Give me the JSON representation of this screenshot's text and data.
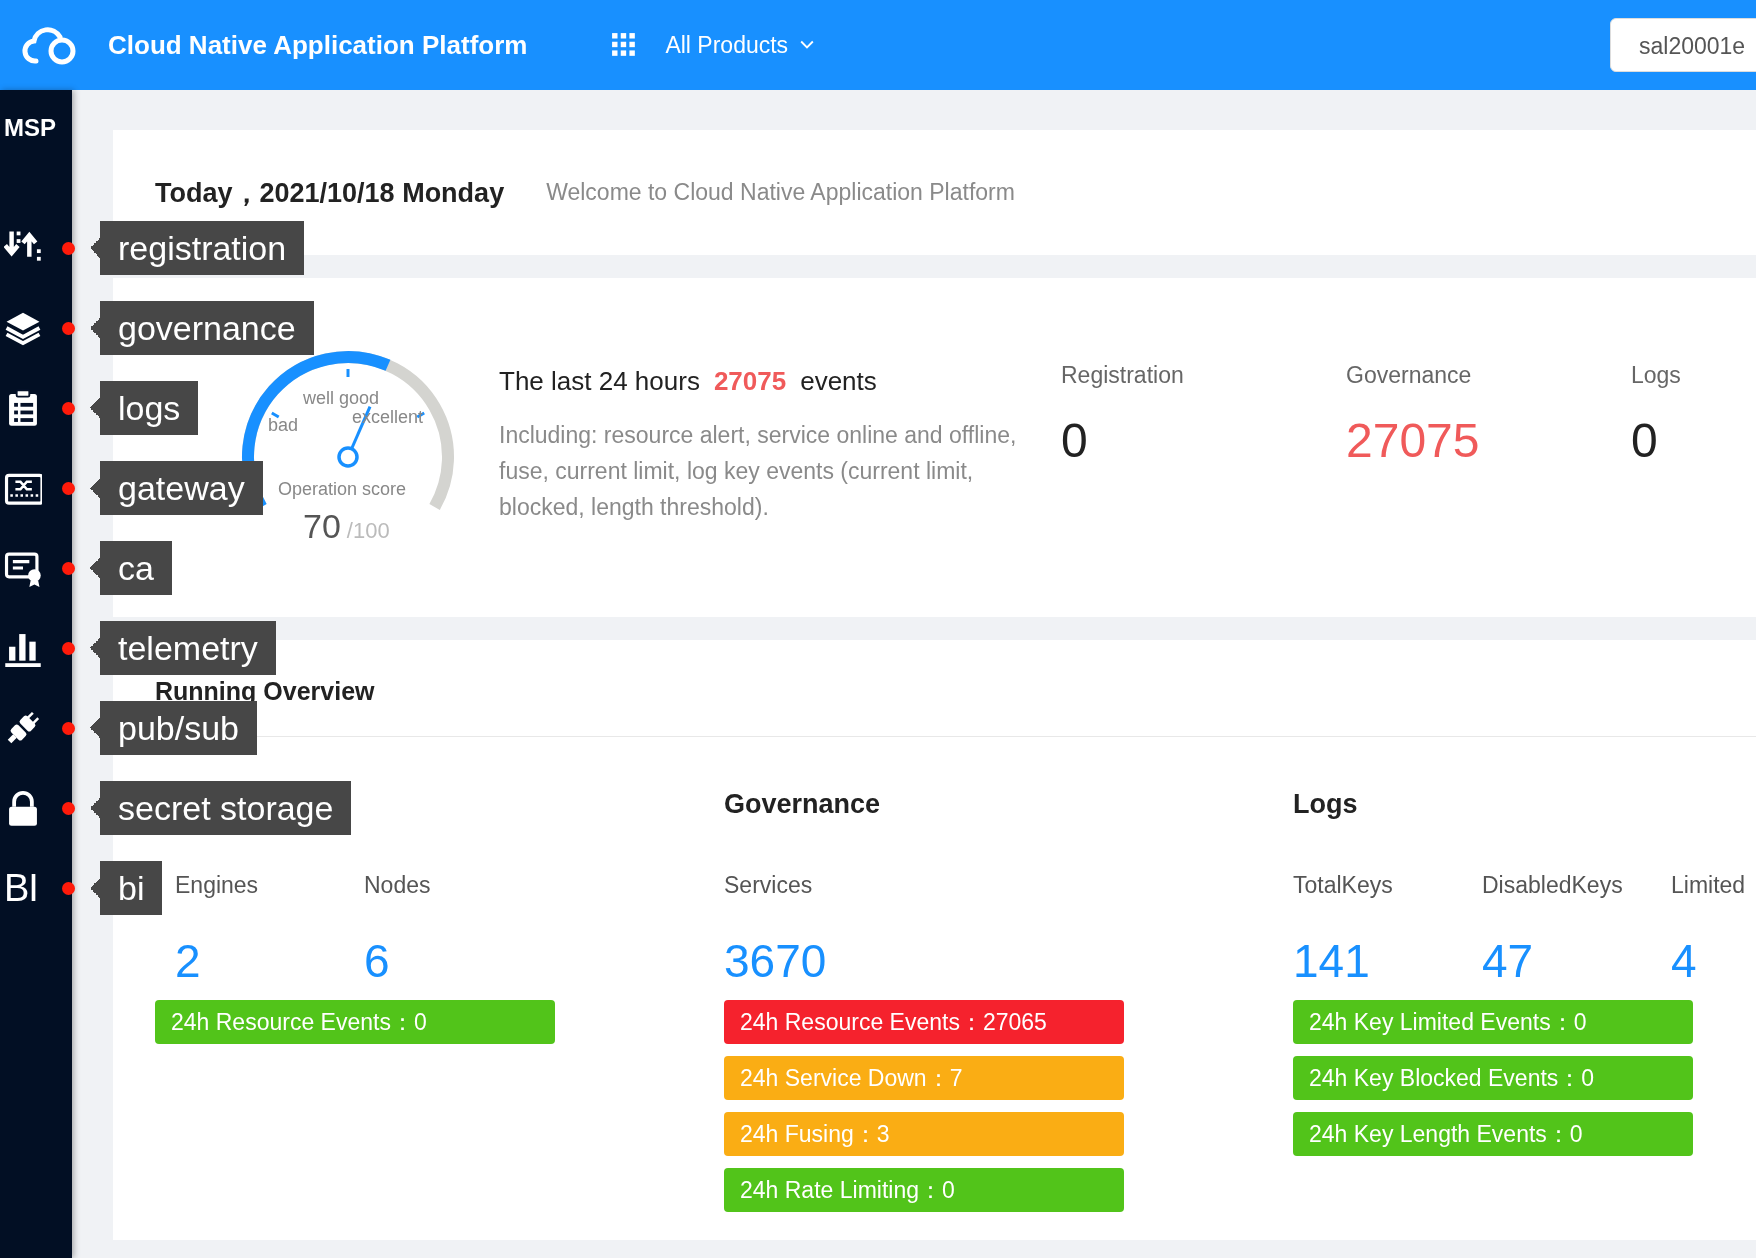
{
  "header": {
    "title": "Cloud Native Application Platform",
    "products_menu": "All Products",
    "user": "sal20001e"
  },
  "sidebar": {
    "title": "MSP",
    "items": [
      {
        "label": "registration",
        "dot": true
      },
      {
        "label": "governance",
        "dot": true
      },
      {
        "label": "logs",
        "dot": true
      },
      {
        "label": "gateway",
        "dot": true
      },
      {
        "label": "ca",
        "dot": true
      },
      {
        "label": "telemetry",
        "dot": true
      },
      {
        "label": "pub/sub",
        "dot": true
      },
      {
        "label": "secret storage",
        "dot": true
      },
      {
        "label": "bi",
        "dot": true,
        "glyph": "BI"
      }
    ]
  },
  "today": {
    "date": "Today，2021/10/18 Monday",
    "welcome": "Welcome to Cloud Native Application Platform"
  },
  "gauge": {
    "level": 0.7,
    "labels": [
      "bad",
      "well good",
      "excellent"
    ],
    "title": "Operation score",
    "score": "70",
    "max": "/100"
  },
  "events": {
    "prefix": "The last 24 hours",
    "count": "27075",
    "suffix": "events",
    "description": "Including: resource alert, service online and offline, fuse, current limit, log key events (current limit, blocked, length threshold)."
  },
  "summary": [
    {
      "label": "Registration",
      "value": "0",
      "alert": false
    },
    {
      "label": "Governance",
      "value": "27075",
      "alert": true
    },
    {
      "label": "Logs",
      "value": "0",
      "alert": false
    }
  ],
  "overview": {
    "title": "Running Overview",
    "groups": [
      {
        "metrics": [
          {
            "label": "Engines",
            "value": "2"
          },
          {
            "label": "Nodes",
            "value": "6"
          }
        ],
        "events": [
          {
            "text": "24h Resource Events：0",
            "color": "#52c41a"
          }
        ]
      },
      {
        "title": "Governance",
        "metrics": [
          {
            "label": "Services",
            "value": "3670"
          }
        ],
        "events": [
          {
            "text": "24h Resource Events：27065",
            "color": "#f5222d"
          },
          {
            "text": "24h Service Down：7",
            "color": "#faad14"
          },
          {
            "text": "24h Fusing：3",
            "color": "#faad14"
          },
          {
            "text": "24h Rate Limiting：0",
            "color": "#52c41a"
          }
        ]
      },
      {
        "title": "Logs",
        "metrics": [
          {
            "label": "TotalKeys",
            "value": "141"
          },
          {
            "label": "DisabledKeys",
            "value": "47"
          },
          {
            "label": "Limited",
            "value": "4"
          }
        ],
        "events": [
          {
            "text": "24h Key Limited Events：0",
            "color": "#52c41a"
          },
          {
            "text": "24h Key Blocked Events：0",
            "color": "#52c41a"
          },
          {
            "text": "24h Key Length Events：0",
            "color": "#52c41a"
          }
        ]
      }
    ]
  }
}
